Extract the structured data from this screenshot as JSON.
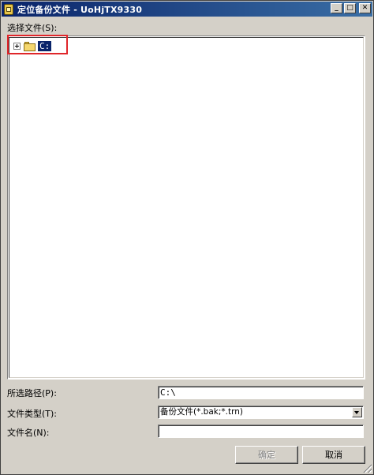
{
  "window": {
    "title": "定位备份文件 - UoHjTX9330",
    "controls": {
      "minimize": "_",
      "maximize": "□",
      "close": "✕"
    }
  },
  "select_file_label": "选择文件(S):",
  "tree": {
    "nodes": [
      {
        "label": "C:",
        "icon": "folder-icon",
        "expanded": false,
        "selected": true
      }
    ]
  },
  "form": {
    "selected_path_label": "所选路径(P):",
    "selected_path_value": "C:\\",
    "file_type_label": "文件类型(T):",
    "file_type_value": "备份文件(*.bak;*.trn)",
    "file_name_label": "文件名(N):",
    "file_name_value": ""
  },
  "buttons": {
    "ok": "确定",
    "cancel": "取消"
  },
  "colors": {
    "annotation_box": "#e0262a",
    "selection": "#0a246a"
  }
}
